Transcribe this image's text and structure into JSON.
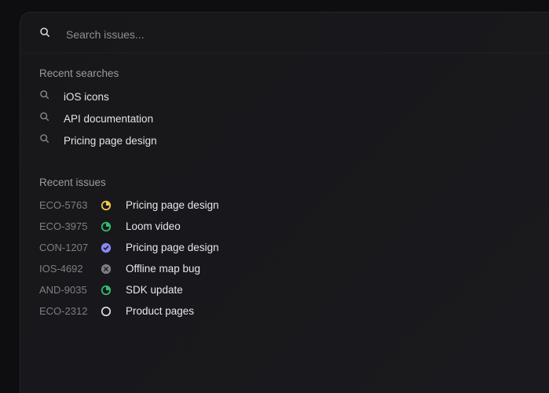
{
  "search": {
    "placeholder": "Search issues..."
  },
  "sections": {
    "recent_searches_label": "Recent searches",
    "recent_issues_label": "Recent issues"
  },
  "recent_searches": [
    {
      "label": "iOS icons"
    },
    {
      "label": "API documentation"
    },
    {
      "label": "Pricing page design"
    }
  ],
  "recent_issues": [
    {
      "id": "ECO-5763",
      "status": "in-progress-yellow",
      "title": "Pricing page design"
    },
    {
      "id": "ECO-3975",
      "status": "in-progress-green",
      "title": "Loom video"
    },
    {
      "id": "CON-1207",
      "status": "done-purple",
      "title": "Pricing page design"
    },
    {
      "id": "IOS-4692",
      "status": "cancelled-grey",
      "title": "Offline map bug"
    },
    {
      "id": "AND-9035",
      "status": "in-progress-green",
      "title": "SDK update"
    },
    {
      "id": "ECO-2312",
      "status": "todo-open",
      "title": "Product pages"
    }
  ],
  "status_colors": {
    "in-progress-yellow": "#f2c94c",
    "in-progress-green": "#2fbf71",
    "done-purple": "#8a88f7",
    "cancelled-grey": "#7d7d85",
    "todo-open": "#d8d8dc"
  }
}
